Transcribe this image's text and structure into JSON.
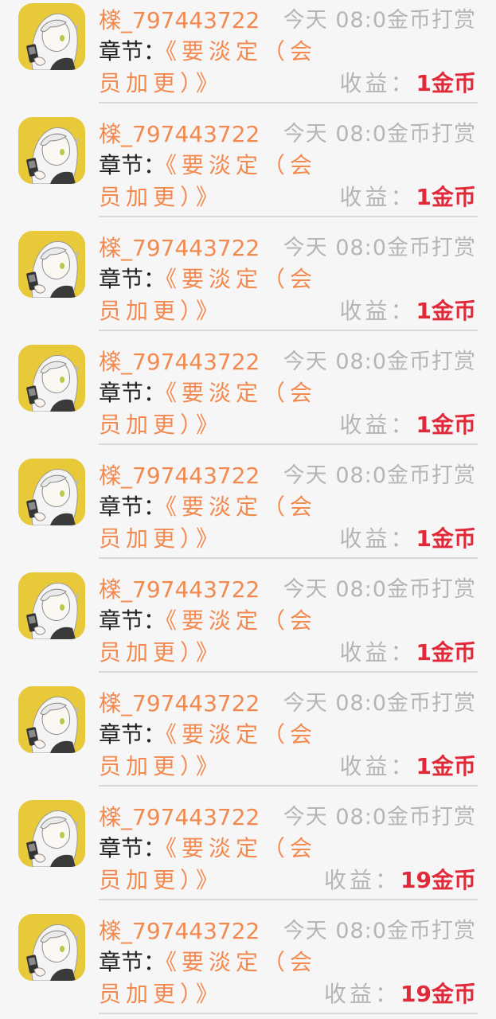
{
  "rows": [
    {
      "username": "檪_797443722",
      "meta": "今天 08:0金币打赏",
      "chapter_label": "章节：",
      "chapter_title_1": "《要淡定（会",
      "chapter_title_2": "员加更）》",
      "income_label": "收益：",
      "income_value": "1金币"
    },
    {
      "username": "檪_797443722",
      "meta": "今天 08:0金币打赏",
      "chapter_label": "章节：",
      "chapter_title_1": "《要淡定（会",
      "chapter_title_2": "员加更）》",
      "income_label": "收益：",
      "income_value": "1金币"
    },
    {
      "username": "檪_797443722",
      "meta": "今天 08:0金币打赏",
      "chapter_label": "章节：",
      "chapter_title_1": "《要淡定（会",
      "chapter_title_2": "员加更）》",
      "income_label": "收益：",
      "income_value": "1金币"
    },
    {
      "username": "檪_797443722",
      "meta": "今天 08:0金币打赏",
      "chapter_label": "章节：",
      "chapter_title_1": "《要淡定（会",
      "chapter_title_2": "员加更）》",
      "income_label": "收益：",
      "income_value": "1金币"
    },
    {
      "username": "檪_797443722",
      "meta": "今天 08:0金币打赏",
      "chapter_label": "章节：",
      "chapter_title_1": "《要淡定（会",
      "chapter_title_2": "员加更）》",
      "income_label": "收益：",
      "income_value": "1金币"
    },
    {
      "username": "檪_797443722",
      "meta": "今天 08:0金币打赏",
      "chapter_label": "章节：",
      "chapter_title_1": "《要淡定（会",
      "chapter_title_2": "员加更）》",
      "income_label": "收益：",
      "income_value": "1金币"
    },
    {
      "username": "檪_797443722",
      "meta": "今天 08:0金币打赏",
      "chapter_label": "章节：",
      "chapter_title_1": "《要淡定（会",
      "chapter_title_2": "员加更）》",
      "income_label": "收益：",
      "income_value": "1金币"
    },
    {
      "username": "檪_797443722",
      "meta": "今天 08:0金币打赏",
      "chapter_label": "章节：",
      "chapter_title_1": "《要淡定（会",
      "chapter_title_2": "员加更）》",
      "income_label": "收益：",
      "income_value": "19金币"
    },
    {
      "username": "檪_797443722",
      "meta": "今天 08:0金币打赏",
      "chapter_label": "章节：",
      "chapter_title_1": "《要淡定（会",
      "chapter_title_2": "员加更）》",
      "income_label": "收益：",
      "income_value": "19金币"
    }
  ],
  "colors": {
    "username": "#f2894f",
    "chapter_title": "#f2894f",
    "meta": "#b5b5b5",
    "income_value": "#e02a3a",
    "avatar_bg": "#e8c93a"
  },
  "icons": {
    "avatar": "user-avatar-anime-girl"
  }
}
